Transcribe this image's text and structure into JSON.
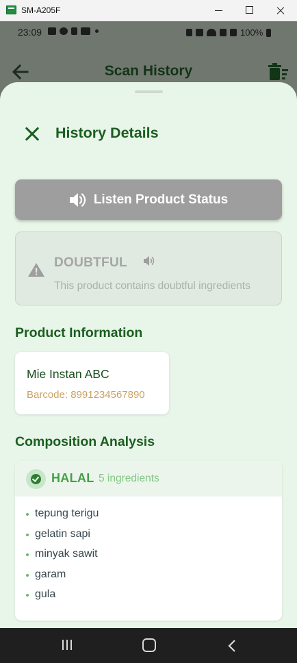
{
  "window": {
    "title": "SM-A205F"
  },
  "status_bar": {
    "time": "23:09",
    "battery": "100%",
    "icons_left": [
      "youtube-icon",
      "account-icon",
      "upload-icon",
      "gamepad-icon",
      "dot-icon"
    ],
    "icons_right": [
      "lock-icon",
      "mute-icon",
      "wifi-icon",
      "signal-icon",
      "signal-icon",
      "battery-icon"
    ]
  },
  "app_bar": {
    "title": "Scan History",
    "back_icon": "arrow-back-icon",
    "action_icon": "delete-sweep-icon"
  },
  "sheet": {
    "title": "History Details",
    "listen_button": {
      "label": "Listen Product Status",
      "icon": "volume-up-icon"
    },
    "status": {
      "label": "DOUBTFUL",
      "description": "This product contains doubtful ingredients",
      "icon": "warning-icon"
    },
    "product_section": {
      "title": "Product Information",
      "name": "Mie Instan ABC",
      "barcode": "Barcode: 8991234567890"
    },
    "composition_section": {
      "title": "Composition Analysis",
      "status": "HALAL",
      "count": "5 ingredients",
      "ingredients": [
        "tepung terigu",
        "gelatin sapi",
        "minyak sawit",
        "garam",
        "gula"
      ]
    }
  },
  "colors": {
    "primary_dark": "#1b5e20",
    "sheet_bg": "#e8f5e9",
    "halal_green": "#43a047",
    "button_disabled": "#9e9e9e",
    "barcode_text": "#c8a260"
  }
}
